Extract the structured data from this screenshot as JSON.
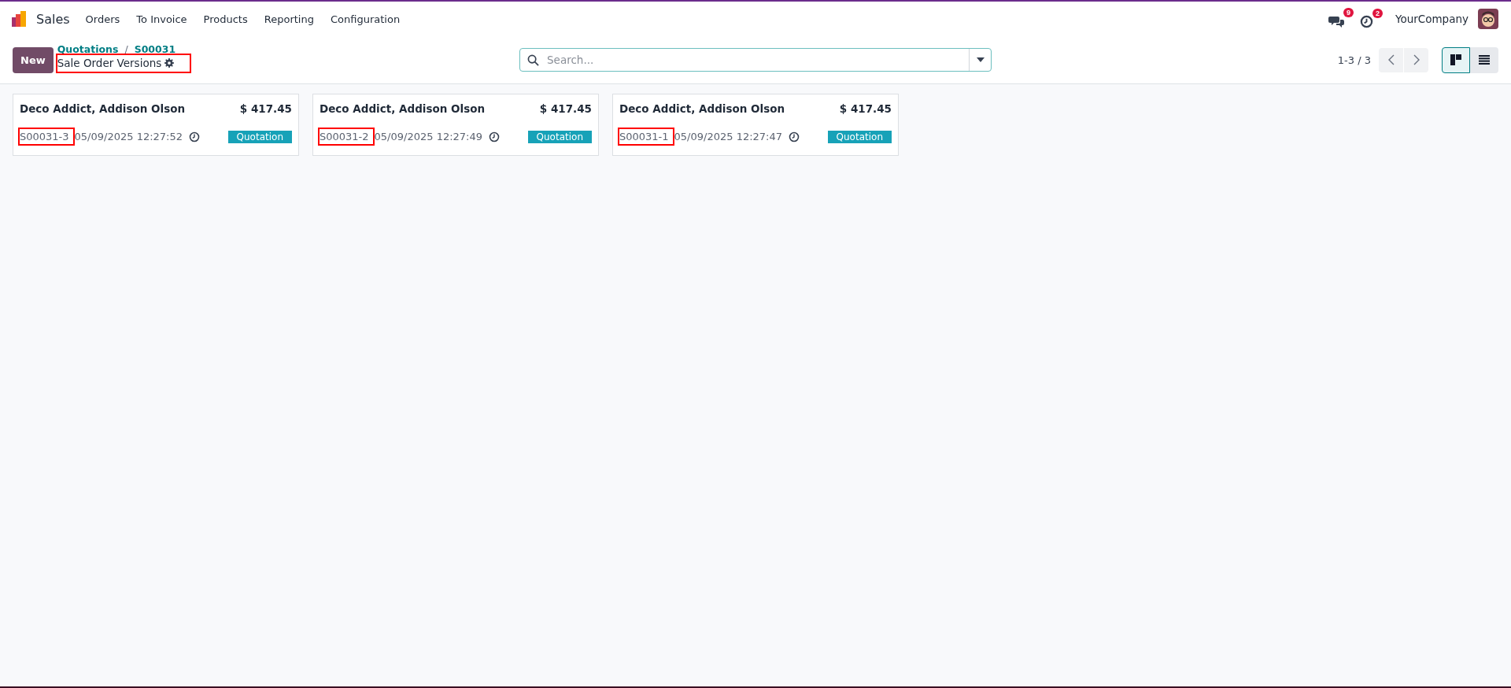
{
  "navbar": {
    "app_name": "Sales",
    "menu": [
      "Orders",
      "To Invoice",
      "Products",
      "Reporting",
      "Configuration"
    ],
    "messages_count": "9",
    "activities_count": "2",
    "company": "YourCompany"
  },
  "control_panel": {
    "new_button": "New",
    "breadcrumbs": [
      "Quotations",
      "S00031"
    ],
    "breadcrumb_separator": "/",
    "title": "Sale Order Versions",
    "title_highlighted": true,
    "search": {
      "placeholder": "Search..."
    },
    "pager": "1-3 / 3",
    "views": [
      {
        "kind": "kanban",
        "selected": true
      },
      {
        "kind": "list",
        "selected": false
      }
    ]
  },
  "cards": [
    {
      "customer": "Deco Addict, Addison Olson",
      "amount": "$ 417.45",
      "reference": "S00031-3",
      "reference_highlighted": true,
      "date": "05/09/2025 12:27:52",
      "status": "Quotation"
    },
    {
      "customer": "Deco Addict, Addison Olson",
      "amount": "$ 417.45",
      "reference": "S00031-2",
      "reference_highlighted": true,
      "date": "05/09/2025 12:27:49",
      "status": "Quotation"
    },
    {
      "customer": "Deco Addict, Addison Olson",
      "amount": "$ 417.45",
      "reference": "S00031-1",
      "reference_highlighted": true,
      "date": "05/09/2025 12:27:47",
      "status": "Quotation"
    }
  ]
}
